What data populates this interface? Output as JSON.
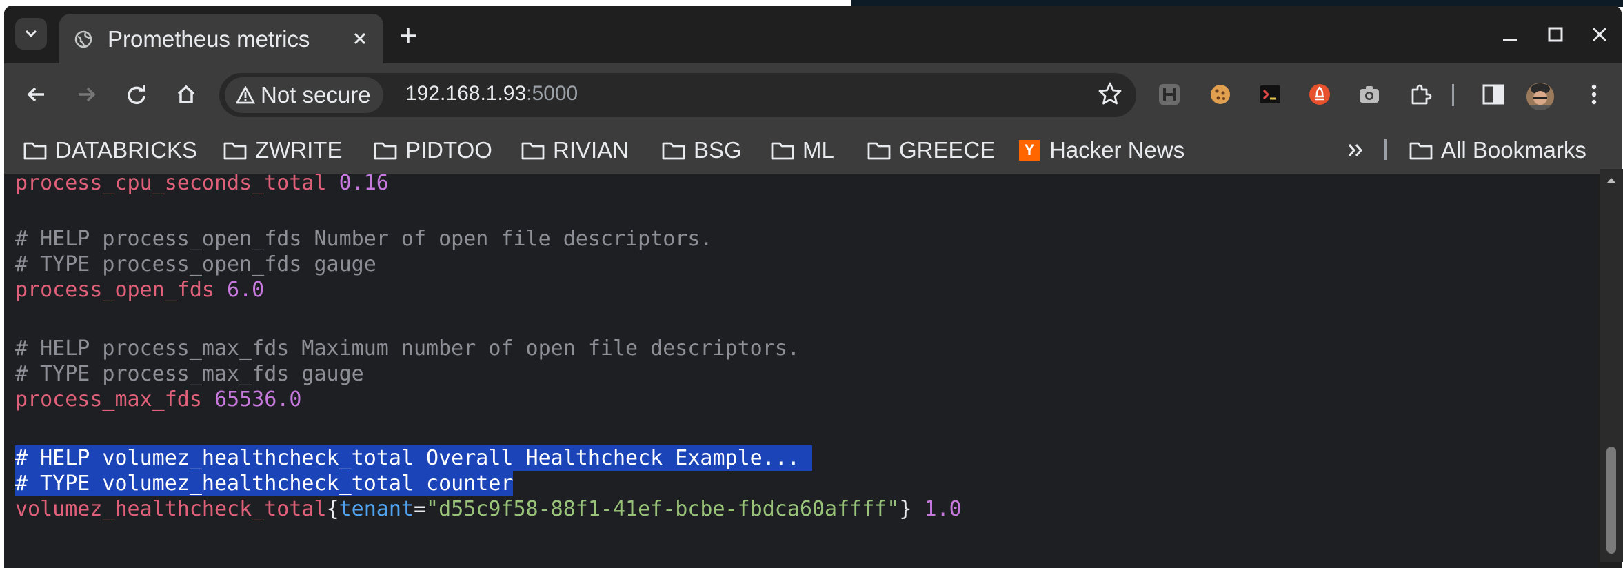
{
  "tab": {
    "title": "Prometheus metrics"
  },
  "omnibox": {
    "security_label": "Not secure",
    "url_host": "192.168.1.93",
    "url_port": ":5000"
  },
  "bookmarks": [
    {
      "label": "DATABRICKS",
      "icon": "folder-icon"
    },
    {
      "label": "ZWRITE",
      "icon": "folder-icon"
    },
    {
      "label": "PIDTOO",
      "icon": "folder-icon"
    },
    {
      "label": "RIVIAN",
      "icon": "folder-icon"
    },
    {
      "label": "BSG",
      "icon": "folder-icon"
    },
    {
      "label": "ML",
      "icon": "folder-icon"
    },
    {
      "label": "GREECE",
      "icon": "folder-icon"
    },
    {
      "label": "Hacker News",
      "icon": "hacker-news-icon",
      "icon_text": "Y"
    }
  ],
  "all_bookmarks": "All Bookmarks",
  "metrics": {
    "l1": {
      "name": "process_cpu_seconds_total",
      "value": "0.16"
    },
    "l2": "# HELP process_open_fds Number of open file descriptors.",
    "l3": "# TYPE process_open_fds gauge",
    "l4": {
      "name": "process_open_fds",
      "value": "6.0"
    },
    "l5": "# HELP process_max_fds Maximum number of open file descriptors.",
    "l6": "# TYPE process_max_fds gauge",
    "l7": {
      "name": "process_max_fds",
      "value": "65536.0"
    },
    "l8": "# HELP volumez_healthcheck_total Overall Healthcheck Example... ",
    "l9": "# TYPE volumez_healthcheck_total counter",
    "l10": {
      "name": "volumez_healthcheck_total",
      "brace_open": "{",
      "label_key": "tenant",
      "eq": "=",
      "label_value": "\"d55c9f58-88f1-41ef-bcbe-fbdca60affff\"",
      "brace_close": "}",
      "value": "1.0"
    }
  },
  "colors": {
    "comment": "#8c8f96",
    "metric_name": "#e0607a",
    "number": "#c678dd",
    "label_key": "#4fa3f0",
    "label_value": "#98c379",
    "selection": "#1a44b8"
  }
}
